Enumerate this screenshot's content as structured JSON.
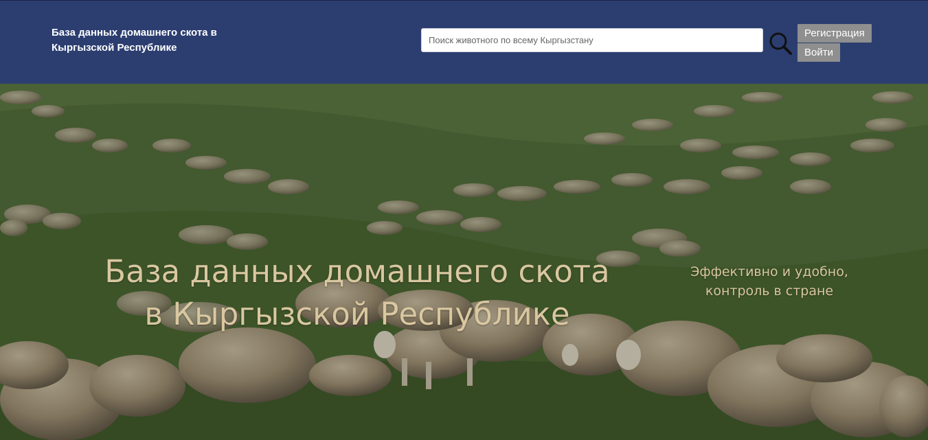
{
  "header": {
    "site_title": "База данных домашнего скота в Кыргызской Республике",
    "search": {
      "placeholder": "Поиск животного по всему Кыргызстану",
      "value": "",
      "icon": "search-icon"
    },
    "register_label": "Регистрация",
    "login_label": "Войти",
    "background_color": "#2c3e70"
  },
  "hero": {
    "title": "База данных домашнего скота в Кыргызской Республике",
    "subtitle": "Эффективно и удобно, контроль в стране",
    "text_color": "#d9c7a0"
  }
}
